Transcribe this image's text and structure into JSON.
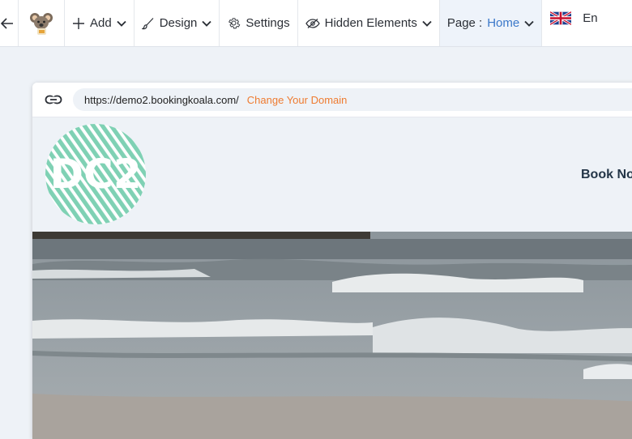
{
  "toolbar": {
    "back_icon": "arrow-left-icon",
    "logo_icon": "koala-logo-icon",
    "add_label": "Add",
    "design_label": "Design",
    "settings_label": "Settings",
    "hidden_label": "Hidden Elements",
    "page_label": "Page :",
    "page_value": "Home",
    "lang_label": "En",
    "lang_flag": "uk-flag-icon"
  },
  "preview": {
    "url": "https://demo2.bookingkoala.com/",
    "change_domain": "Change Your Domain",
    "logo_text": "DC2",
    "nav_book": "Book Now"
  },
  "colors": {
    "accent_orange": "#ee7b30",
    "page_blue": "#3b78c9",
    "logo_teal": "#7fd1b4",
    "background": "#eef2f7"
  }
}
